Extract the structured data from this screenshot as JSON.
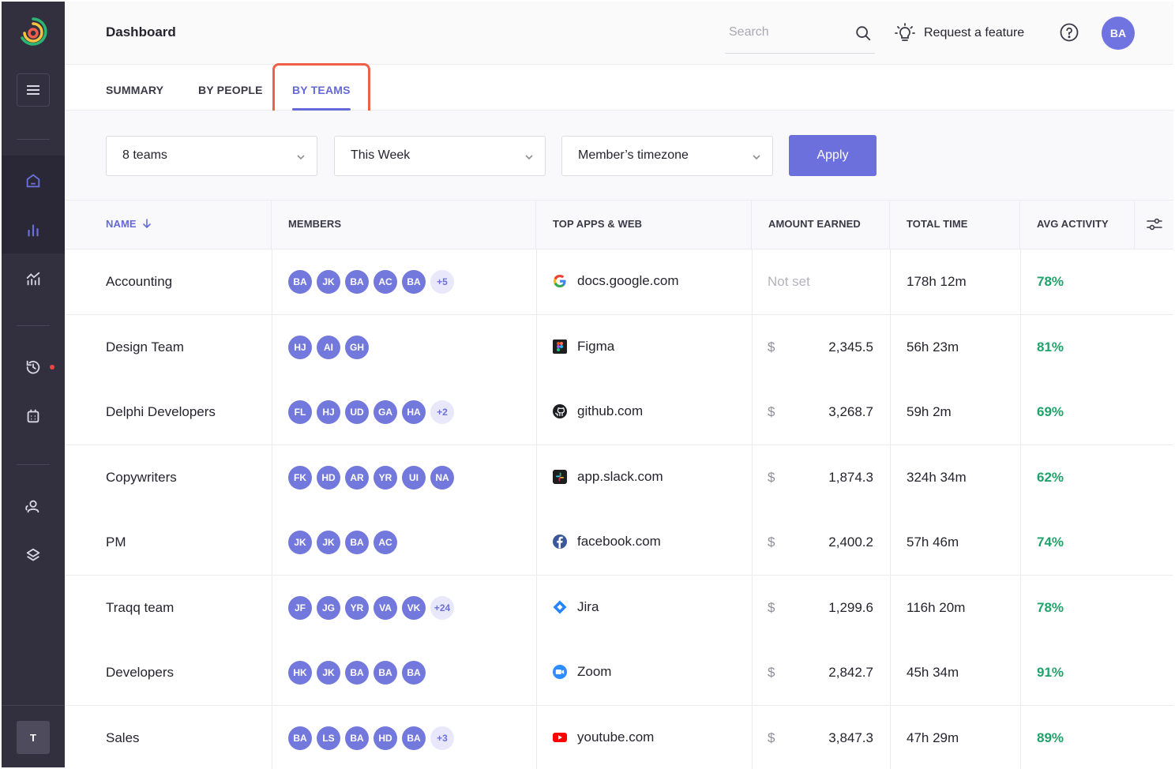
{
  "header": {
    "title": "Dashboard",
    "search_placeholder": "Search",
    "request_feature": "Request a feature",
    "user_initials": "BA"
  },
  "sidebar": {
    "workspace_initial": "T",
    "icons": [
      "home-icon",
      "bar-chart-icon",
      "trend-chart-icon",
      "history-icon",
      "calendar-icon",
      "people-icon",
      "layers-icon"
    ]
  },
  "tabs": [
    {
      "label": "SUMMARY"
    },
    {
      "label": "BY PEOPLE"
    },
    {
      "label": "BY TEAMS",
      "active": true
    }
  ],
  "filters": {
    "teams": "8 teams",
    "period": "This Week",
    "timezone": "Member’s timezone",
    "apply": "Apply"
  },
  "table": {
    "columns": [
      "NAME",
      "MEMBERS",
      "TOP APPS & WEB",
      "AMOUNT EARNED",
      "TOTAL TIME",
      "AVG ACTIVITY"
    ],
    "rows": [
      {
        "name": "Accounting",
        "members": [
          "BA",
          "JK",
          "BA",
          "AC",
          "BA"
        ],
        "more": "+5",
        "app": "docs.google.com",
        "app_icon": "google-icon",
        "currency": "",
        "earned": "Not set",
        "time": "178h 12m",
        "activity": "78%"
      },
      {
        "name": "Design Team",
        "members": [
          "HJ",
          "AI",
          "GH"
        ],
        "more": "",
        "app": "Figma",
        "app_icon": "figma-icon",
        "currency": "$",
        "earned": "2,345.5",
        "time": "56h 23m",
        "activity": "81%"
      },
      {
        "name": "Delphi Developers",
        "members": [
          "FL",
          "HJ",
          "UD",
          "GA",
          "HA"
        ],
        "more": "+2",
        "app": "github.com",
        "app_icon": "github-icon",
        "currency": "$",
        "earned": "3,268.7",
        "time": "59h 2m",
        "activity": "69%"
      },
      {
        "name": "Copywriters",
        "members": [
          "FK",
          "HD",
          "AR",
          "YR",
          "UI",
          "NA"
        ],
        "more": "",
        "app": "app.slack.com",
        "app_icon": "slack-icon",
        "currency": "$",
        "earned": "1,874.3",
        "time": "324h 34m",
        "activity": "62%"
      },
      {
        "name": "PM",
        "members": [
          "JK",
          "JK",
          "BA",
          "AC"
        ],
        "more": "",
        "app": "facebook.com",
        "app_icon": "facebook-icon",
        "currency": "$",
        "earned": "2,400.2",
        "time": "57h 46m",
        "activity": "74%"
      },
      {
        "name": "Traqq team",
        "members": [
          "JF",
          "JG",
          "YR",
          "VA",
          "VK"
        ],
        "more": "+24",
        "app": "Jira",
        "app_icon": "jira-icon",
        "currency": "$",
        "earned": "1,299.6",
        "time": "116h 20m",
        "activity": "78%"
      },
      {
        "name": "Developers",
        "members": [
          "HK",
          "JK",
          "BA",
          "BA",
          "BA"
        ],
        "more": "",
        "app": "Zoom",
        "app_icon": "zoom-icon",
        "currency": "$",
        "earned": "2,842.7",
        "time": "45h 34m",
        "activity": "91%"
      },
      {
        "name": "Sales",
        "members": [
          "BA",
          "LS",
          "BA",
          "HD",
          "BA"
        ],
        "more": "+3",
        "app": "youtube.com",
        "app_icon": "youtube-icon",
        "currency": "$",
        "earned": "3,847.3",
        "time": "47h 29m",
        "activity": "89%"
      }
    ]
  }
}
